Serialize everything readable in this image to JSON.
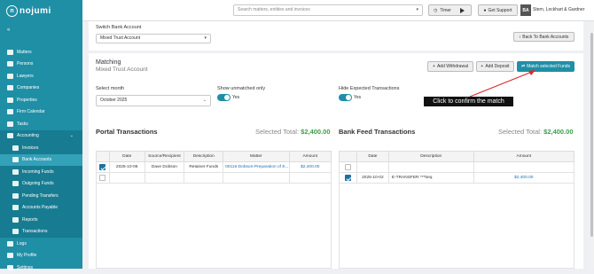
{
  "header": {
    "logo": "nojumi",
    "search_placeholder": "Search matters, entities and invoices",
    "timer_label": "Timer",
    "support_label": "Get Support",
    "avatar_initials": "BA",
    "firm_name": "Stern, Lockhart & Gardner"
  },
  "sidebar": {
    "items": [
      {
        "label": "Matters"
      },
      {
        "label": "Persons"
      },
      {
        "label": "Lawyers"
      },
      {
        "label": "Companies"
      },
      {
        "label": "Properties"
      },
      {
        "label": "Firm Calendar"
      },
      {
        "label": "Tasks"
      },
      {
        "label": "Accounting"
      },
      {
        "label": "Invoices"
      },
      {
        "label": "Bank Accounts"
      },
      {
        "label": "Incoming Funds"
      },
      {
        "label": "Outgoing Funds"
      },
      {
        "label": "Pending Transfers"
      },
      {
        "label": "Accounts Payable"
      },
      {
        "label": "Reports"
      },
      {
        "label": "Transactions"
      },
      {
        "label": "Logs"
      },
      {
        "label": "My Profile"
      },
      {
        "label": "Settings"
      }
    ]
  },
  "switch": {
    "label": "Switch Bank Account",
    "value": "Mixed Trust Account",
    "back_label": "Back To Bank Accounts"
  },
  "matching": {
    "title": "Matching",
    "subtitle": "Mixed Trust Account",
    "add_withdrawal": "Add Withdrawal",
    "add_deposit": "Add Deposit",
    "match_selected": "Match selected Funds",
    "select_month_label": "Select month",
    "month_value": "October 2025",
    "unmatched_label": "Show unmatched only",
    "unmatched_value": "Yes",
    "hide_expected_label": "Hide Expected Transactions",
    "hide_expected_value": "Yes",
    "callout": "Click to confirm the match"
  },
  "portal": {
    "title": "Portal Transactions",
    "selected_total_label": "Selected Total:",
    "selected_total": "$2,400.00",
    "columns": [
      "Date",
      "Source/Recipient",
      "Description",
      "Matter",
      "Amount"
    ],
    "rows": [
      {
        "date": "2025-10-06",
        "source": "Dave Dobson",
        "description": "Retainer Funds",
        "matter": "00116-Dobson-Preparation of E...",
        "amount": "$2,400.00"
      }
    ]
  },
  "bank": {
    "title": "Bank Feed Transactions",
    "selected_total_label": "Selected Total:",
    "selected_total": "$2,400.00",
    "columns": [
      "Date",
      "Description",
      "Amount"
    ],
    "rows": [
      {
        "date": "2025-10-02",
        "description": "E-TRANSFER ***5eq",
        "amount": "$2,400.00"
      }
    ]
  },
  "colors": {
    "accent": "#1f8fa6",
    "callout_bg": "#111111",
    "arrow": "#e0262a",
    "total": "#3a9e4a"
  }
}
